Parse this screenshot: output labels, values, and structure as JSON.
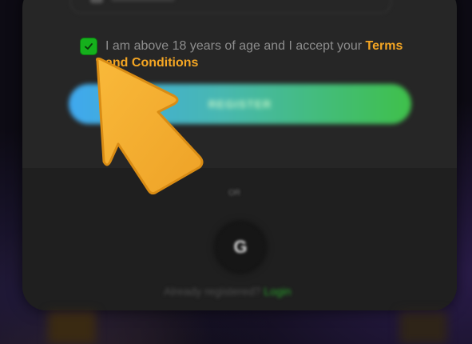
{
  "signup": {
    "checkbox_checked": true,
    "terms_text": "I am above 18 years of age and I accept your ",
    "terms_link": "Terms and Conditions",
    "register_label": "REGISTER",
    "divider_text": "OR",
    "google_label": "G",
    "already_text": "Already registered?",
    "login_label": "Login"
  },
  "colors": {
    "checkbox": "#15b01c",
    "terms_link": "#f5a623",
    "button_start": "#3fa8ef",
    "button_end": "#3fc04a",
    "pointer": "#f5a623"
  },
  "icons": {
    "checkbox": "checkmark-icon",
    "google": "google-icon",
    "pointer": "hand-pointer-arrow-icon",
    "input": "phone-icon"
  }
}
